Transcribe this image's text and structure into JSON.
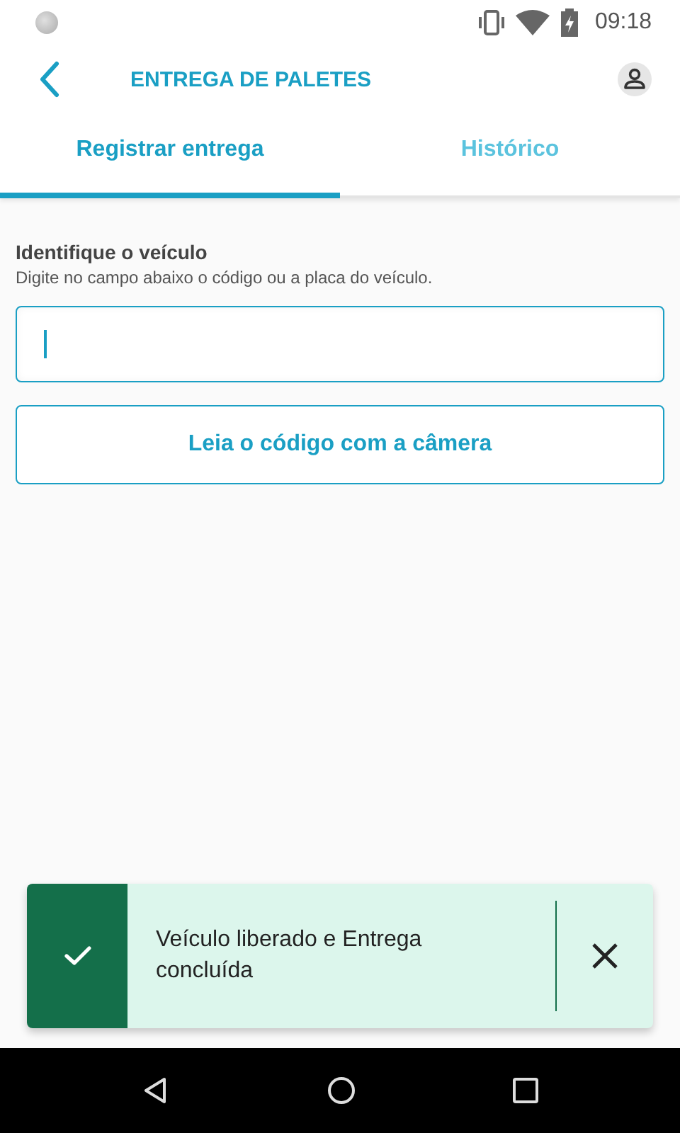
{
  "status_bar": {
    "time": "09:18"
  },
  "app_bar": {
    "title": "ENTREGA DE PALETES"
  },
  "tabs": [
    {
      "label": "Registrar entrega",
      "selected": true
    },
    {
      "label": "Histórico",
      "selected": false
    }
  ],
  "vehicle_form": {
    "title": "Identifique o veículo",
    "hint": "Digite no campo abaixo o código ou a placa do veículo.",
    "field": {
      "focused": true
    },
    "camera_button": "Leia o código com a câmera"
  },
  "toast": {
    "kind": "success",
    "message": "Veículo liberado e Entrega concluída"
  }
}
